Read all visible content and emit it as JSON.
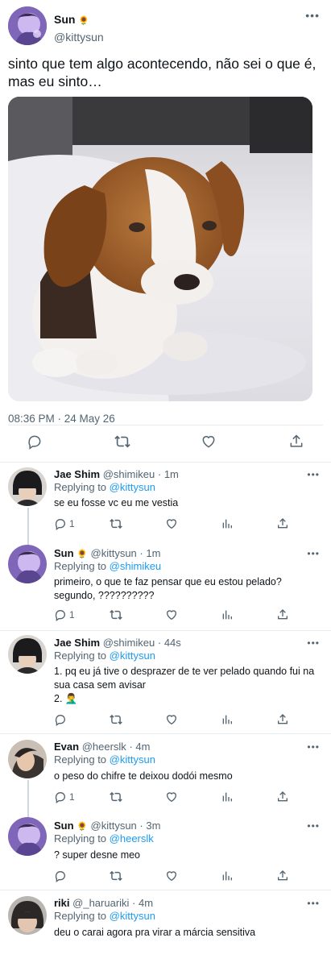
{
  "main_tweet": {
    "name": "Sun",
    "name_emoji": "🌻",
    "handle": "@kittysun",
    "text": "sinto que tem algo acontecendo, não sei o que é, mas eu sinto…",
    "timestamp": "08:36 PM · 24 May 26",
    "more": "•••"
  },
  "replies": [
    {
      "name": "Jae Shim",
      "emoji": "",
      "handle": "@shimikeu",
      "time": "1m",
      "replying_label": "Replying to",
      "replying_to": "@kittysun",
      "text": "se eu fosse vc eu me vestia",
      "reply_count": "1",
      "more": "•••"
    },
    {
      "name": "Sun",
      "emoji": "🌻",
      "handle": "@kittysun",
      "time": "1m",
      "replying_label": "Replying to",
      "replying_to": "@shimikeu",
      "text": "primeiro, o que te faz pensar que eu estou pelado?\nsegundo, ??????????",
      "reply_count": "1",
      "more": "•••"
    },
    {
      "name": "Jae Shim",
      "emoji": "",
      "handle": "@shimikeu",
      "time": "44s",
      "replying_label": "Replying to",
      "replying_to": "@kittysun",
      "text": "1. pq eu já tive o desprazer de te ver pelado quando fui na sua casa sem avisar\n2. 🤦‍♂️",
      "reply_count": "",
      "more": "•••"
    },
    {
      "name": "Evan",
      "emoji": "",
      "handle": "@heerslk",
      "time": "4m",
      "replying_label": "Replying to",
      "replying_to": "@kittysun",
      "text": "o peso do chifre te deixou dodói mesmo",
      "reply_count": "1",
      "more": "•••"
    },
    {
      "name": "Sun",
      "emoji": "🌻",
      "handle": "@kittysun",
      "time": "3m",
      "replying_label": "Replying to",
      "replying_to": "@heerslk",
      "text": "? super desne meo",
      "reply_count": "",
      "more": "•••"
    },
    {
      "name": "riki",
      "emoji": "",
      "handle": "@_haruariki",
      "time": "4m",
      "replying_label": "Replying to",
      "replying_to": "@kittysun",
      "text": "deu o carai agora pra virar a márcia sensitiva",
      "reply_count": "",
      "more": "•••"
    }
  ],
  "icons": [
    "reply-icon",
    "retweet-icon",
    "like-icon",
    "analytics-icon",
    "share-icon",
    "more-icon"
  ],
  "colors": {
    "accent": "#1d9bf0",
    "secondary_text": "#536471",
    "border": "#e6ecf0"
  }
}
